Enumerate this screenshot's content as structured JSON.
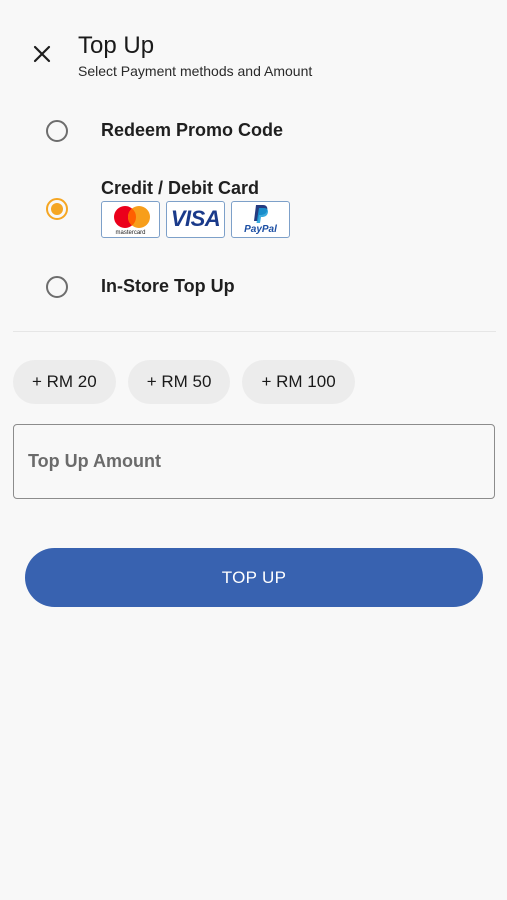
{
  "header": {
    "title": "Top Up",
    "subtitle": "Select Payment methods and Amount",
    "close_icon": "close-icon"
  },
  "payment_methods": [
    {
      "label": "Redeem Promo Code",
      "selected": false
    },
    {
      "label": "Credit / Debit Card",
      "selected": true
    },
    {
      "label": "In-Store Top Up",
      "selected": false
    }
  ],
  "card_logos": {
    "mastercard": "mastercard",
    "visa": "VISA",
    "paypal": "PayPal"
  },
  "quick_amounts": [
    "+ RM 20",
    "+ RM 50",
    "+ RM 100"
  ],
  "amount_field": {
    "placeholder": "Top Up Amount",
    "value": ""
  },
  "submit": {
    "label": "TOP UP"
  },
  "colors": {
    "accent": "#f5a623",
    "primary_button": "#3862b0",
    "background": "#f8f8f8"
  }
}
